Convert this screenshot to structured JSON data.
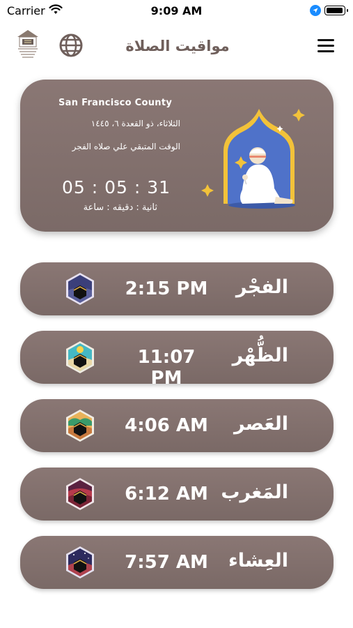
{
  "status_bar": {
    "carrier": "Carrier",
    "time": "9:09 AM"
  },
  "header": {
    "title": "مواقيت الصلاة"
  },
  "card": {
    "county": "San Francisco County",
    "hijri_date": "الثلاثاء، ذو القعدة ٦، ١٤٤٥",
    "remaining_label": "الوقت المتبقي علي صلاه الفجر",
    "timer": "05 : 05 : 31",
    "units": "ثانية : دقيقه : ساعة"
  },
  "prayers": [
    {
      "name": "الفجْر",
      "time": "2:15 PM",
      "icon": "kaaba-fajr-icon",
      "color": "#3b3f7a"
    },
    {
      "name": "الظُّهْر",
      "time": "11:07 PM",
      "icon": "kaaba-dhuhr-icon",
      "color": "#45b8c4"
    },
    {
      "name": "العَصر",
      "time": "4:06 AM",
      "icon": "kaaba-asr-icon",
      "color": "#e8b25a"
    },
    {
      "name": "المَغرب",
      "time": "6:12 AM",
      "icon": "kaaba-maghrib-icon",
      "color": "#b73a4c"
    },
    {
      "name": "العِشاء",
      "time": "7:57 AM",
      "icon": "kaaba-isha-icon",
      "color": "#2d2a5e"
    }
  ],
  "colors": {
    "card": "#8a7774",
    "accent_gold": "#f2c23a",
    "mihrab_blue": "#4f72c9"
  }
}
